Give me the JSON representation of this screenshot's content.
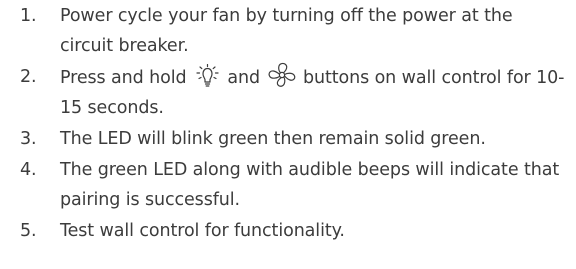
{
  "steps": [
    {
      "num": "1.",
      "text": "Power cycle your fan by turning off the power at the circuit breaker."
    },
    {
      "num": "2.",
      "before": "Press and hold ",
      "middle": " and ",
      "after": " buttons on wall control for 10-15 seconds.",
      "icons": [
        "light-bulb-icon",
        "fan-icon"
      ]
    },
    {
      "num": "3.",
      "text": "The LED will blink green then remain solid green."
    },
    {
      "num": "4.",
      "text": "The green LED along with audible beeps will indicate that pairing is successful."
    },
    {
      "num": "5.",
      "text": "Test wall control for functionality."
    }
  ],
  "colors": {
    "text": "#3c3c3c"
  }
}
